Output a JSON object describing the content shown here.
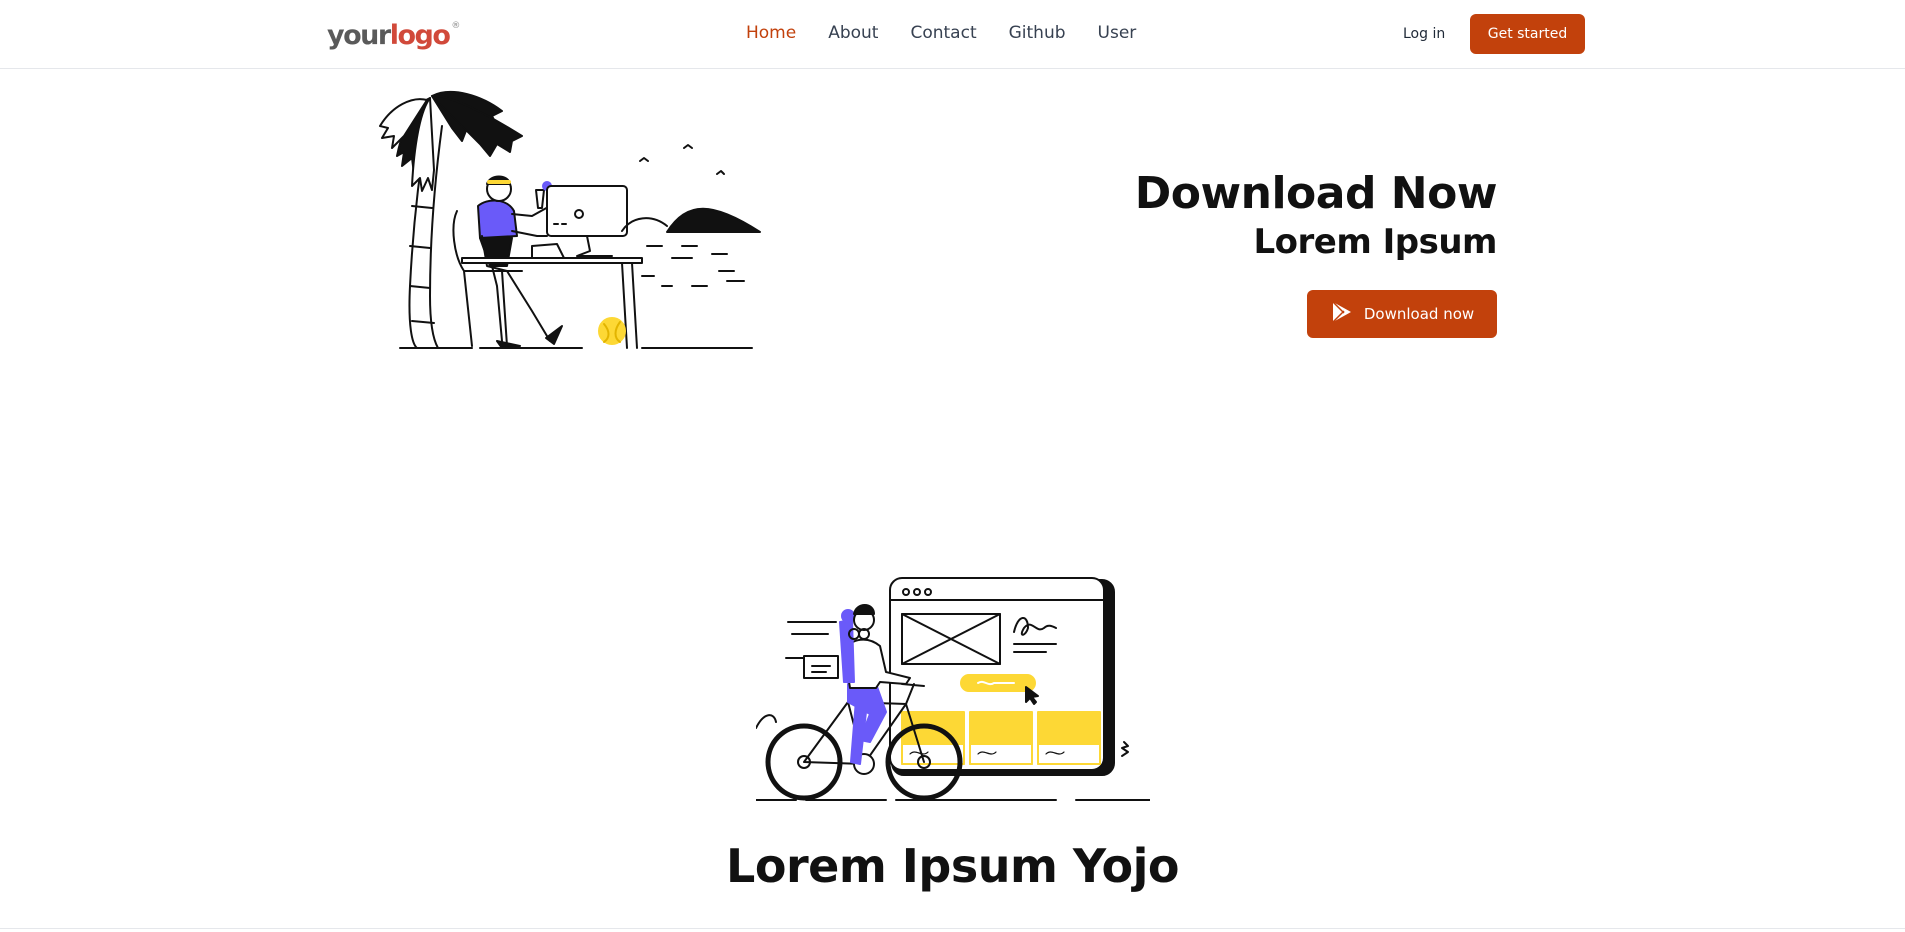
{
  "brand": {
    "logo_part1": "your",
    "logo_part2": "logo",
    "logo_mark": "®"
  },
  "nav": {
    "links": [
      "Home",
      "About",
      "Contact",
      "Github",
      "User"
    ],
    "active": "Home",
    "login_label": "Log in",
    "cta_label": "Get started"
  },
  "hero": {
    "title": "Download Now",
    "subtitle": "Lorem Ipsum",
    "button_label": "Download now",
    "button_icon": "play-store-icon",
    "illustration": "person-working-on-beach-illustration"
  },
  "section": {
    "illustration": "cyclist-with-website-illustration",
    "title": "Lorem Ipsum Yojo"
  },
  "colors": {
    "accent": "#c2410c",
    "purple": "#6a5af9",
    "yellow": "#fdd835",
    "logo_red": "#d1493a",
    "logo_gray": "#5a5a5a"
  }
}
